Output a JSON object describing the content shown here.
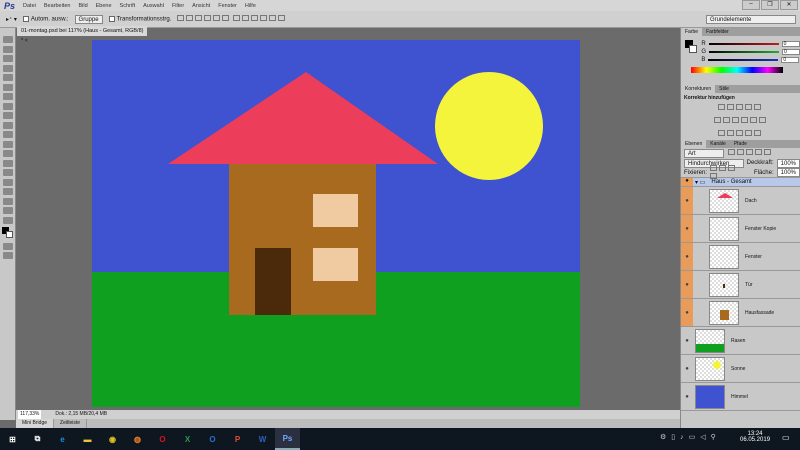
{
  "app": {
    "logo": "Ps",
    "menu": [
      "Datei",
      "Bearbeiten",
      "Bild",
      "Ebene",
      "Schrift",
      "Auswahl",
      "Filter",
      "Ansicht",
      "Fenster",
      "Hilfe"
    ],
    "window_controls": [
      "–",
      "❐",
      "✕"
    ],
    "workspace": "Grundelemente"
  },
  "options": {
    "auto_select_label": "Autom. ausw.:",
    "auto_select_value": "Gruppe",
    "transform_label": "Transformationsstrg."
  },
  "document": {
    "tab_title": "01-montag.psd bei 117% (Haus - Gesamt, RGB/8) *",
    "close": "×"
  },
  "status": {
    "zoom": "117,33%",
    "doc": "Dok.: 2,15 MB/20,4 MB"
  },
  "bottom_tabs": [
    "Mini Bridge",
    "Zeitleiste"
  ],
  "color_panel": {
    "tabs": [
      "Farbe",
      "Farbfelder"
    ],
    "channels": [
      {
        "label": "R",
        "value": "0",
        "color": "#c02020"
      },
      {
        "label": "G",
        "value": "0",
        "color": "#20b030"
      },
      {
        "label": "B",
        "value": "0",
        "color": "#2030c0"
      }
    ]
  },
  "adjust_panel": {
    "tabs": [
      "Korrekturen",
      "Stile"
    ],
    "title": "Korrektur hinzufügen"
  },
  "layers_panel": {
    "tabs": [
      "Ebenen",
      "Kanäle",
      "Pfade"
    ],
    "filter": "Art",
    "blend": "Hindurchwirken",
    "opacity_label": "Deckkraft:",
    "opacity": "100%",
    "lock_label": "Fixieren:",
    "fill_label": "Fläche:",
    "fill": "100%",
    "group": "Haus - Gesamt",
    "layers": [
      {
        "name": "Dach",
        "child": true
      },
      {
        "name": "Fenster Kopie",
        "child": true
      },
      {
        "name": "Fenster",
        "child": true
      },
      {
        "name": "Tür",
        "child": true
      },
      {
        "name": "Hausfassade",
        "child": true
      },
      {
        "name": "Rasen",
        "child": false
      },
      {
        "name": "Sonne",
        "child": false
      },
      {
        "name": "Himmel",
        "child": false
      }
    ]
  },
  "taskbar": {
    "time": "13:24",
    "date": "06.05.2019",
    "apps": [
      "windows-start",
      "task-view",
      "edge",
      "explorer",
      "chrome",
      "firefox",
      "opera",
      "excel",
      "outlook",
      "powerpoint",
      "word",
      "photoshop"
    ]
  },
  "colors": {
    "sky": "#3f52cf",
    "grass": "#10a020",
    "roof": "#ec3d5a",
    "house": "#a86a1e",
    "window": "#f0caa0",
    "door": "#4a2a0a",
    "sun": "#f4f43c"
  }
}
